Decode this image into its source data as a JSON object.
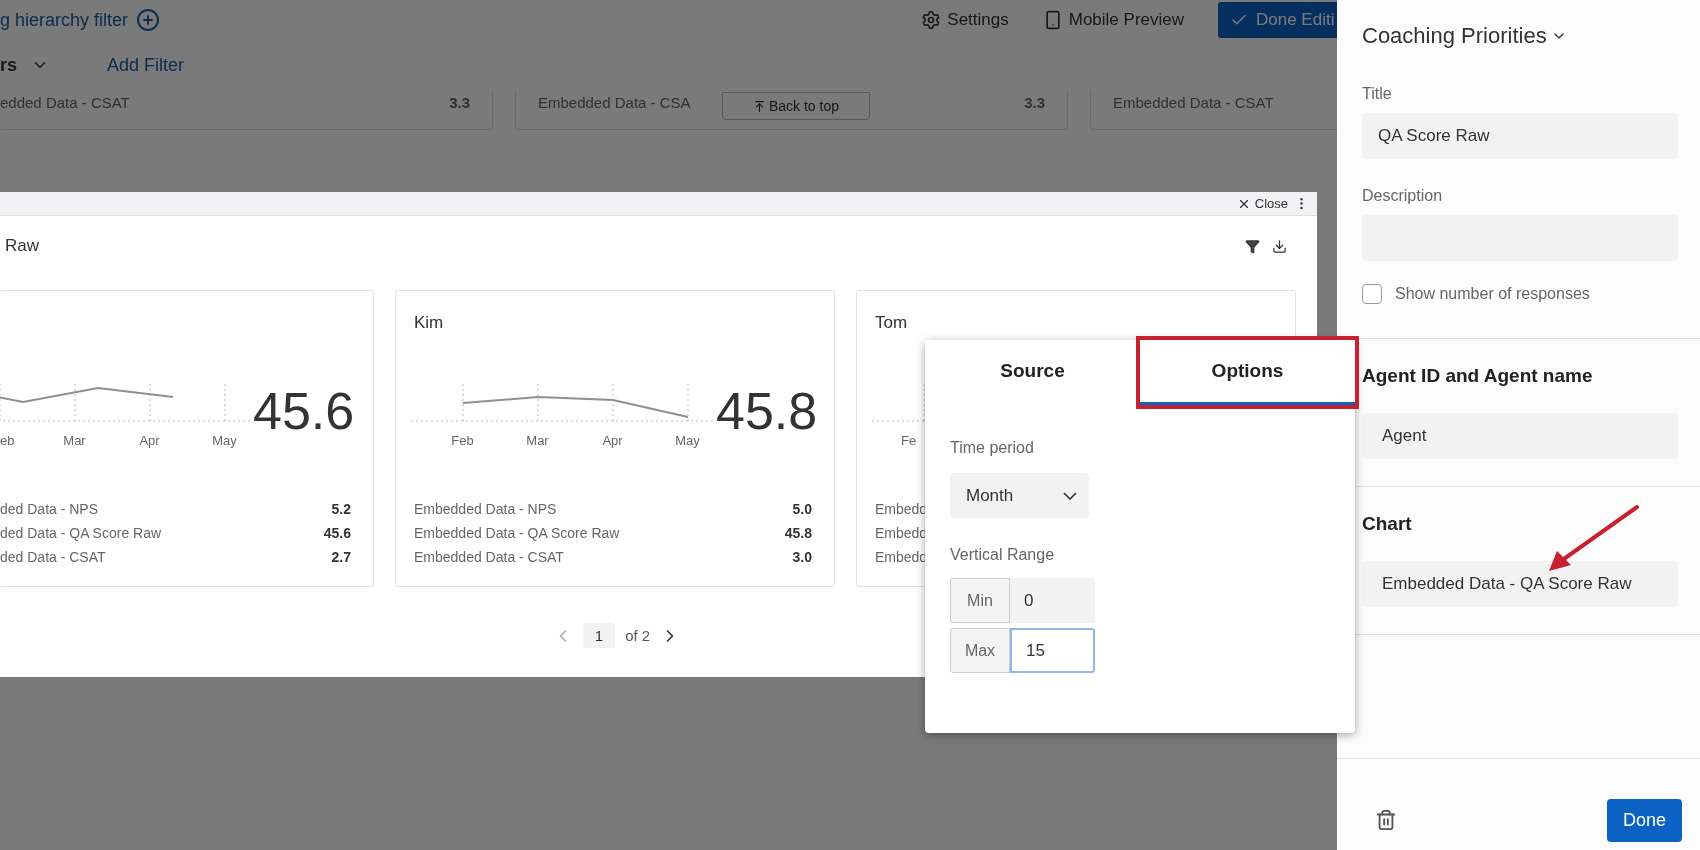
{
  "page_header": {
    "hierarchy_filter_link": "g hierarchy filter",
    "actions": [
      {
        "kind": "settings",
        "label": "Settings"
      },
      {
        "kind": "mobile",
        "label": "Mobile Preview"
      },
      {
        "kind": "done",
        "label": "Done Editi"
      }
    ]
  },
  "filter_bar": {
    "dropdown_label": "rs",
    "add_filter": "Add Filter"
  },
  "background_cards": [
    {
      "label": "edded Data - CSAT",
      "value": "3.3"
    },
    {
      "label": "Embedded Data - CSA",
      "value": "3.3"
    },
    {
      "label": "Embedded Data - CSAT"
    }
  ],
  "back_to_top": "Back to top",
  "modal": {
    "close": "Close",
    "title": "Raw",
    "cards": [
      {
        "kind": "cut_left",
        "x_labels": [
          "eb",
          "Mar",
          "Apr",
          "May"
        ],
        "score": "45.6",
        "metrics": [
          {
            "label": "ded Data - NPS",
            "value": "5.2"
          },
          {
            "label": "ded Data - QA Score Raw",
            "value": "45.6"
          },
          {
            "label": "ded Data - CSAT",
            "value": "2.7"
          }
        ]
      },
      {
        "kind": "full",
        "name": "Kim",
        "x_labels": [
          "Feb",
          "Mar",
          "Apr",
          "May"
        ],
        "score": "45.8",
        "metrics": [
          {
            "label": "Embedded Data - NPS",
            "value": "5.0"
          },
          {
            "label": "Embedded Data - QA Score Raw",
            "value": "45.8"
          },
          {
            "label": "Embedded Data - CSAT",
            "value": "3.0"
          }
        ]
      },
      {
        "kind": "covered",
        "name": "Tom",
        "x_labels": [
          "Fe"
        ],
        "metrics": [
          {
            "label": "Embedd"
          },
          {
            "label": "Embedd"
          },
          {
            "label": "Embedd"
          }
        ]
      }
    ],
    "pagination": {
      "page": "1",
      "total": "of 2"
    }
  },
  "popover": {
    "tabs": [
      {
        "label": "Source",
        "selected": false,
        "highlighted": false
      },
      {
        "label": "Options",
        "selected": true,
        "highlighted": true
      }
    ],
    "time_period": {
      "label": "Time period",
      "value": "Month"
    },
    "vertical_range": {
      "label": "Vertical Range",
      "fields": [
        {
          "label": "Min",
          "value": "0",
          "focused": false
        },
        {
          "label": "Max",
          "value": "15",
          "focused": true
        }
      ]
    }
  },
  "side_panel": {
    "title": "Coaching Priorities",
    "fields": [
      {
        "label": "Title",
        "value": "QA Score Raw"
      },
      {
        "label": "Description"
      }
    ],
    "show_responses": {
      "label": "Show number of responses",
      "checked": false
    },
    "sections": [
      {
        "heading": "Agent ID and Agent name",
        "value": "Agent"
      },
      {
        "heading": "Chart",
        "value": "Embedded Data - QA Score Raw"
      }
    ],
    "done": "Done"
  }
}
